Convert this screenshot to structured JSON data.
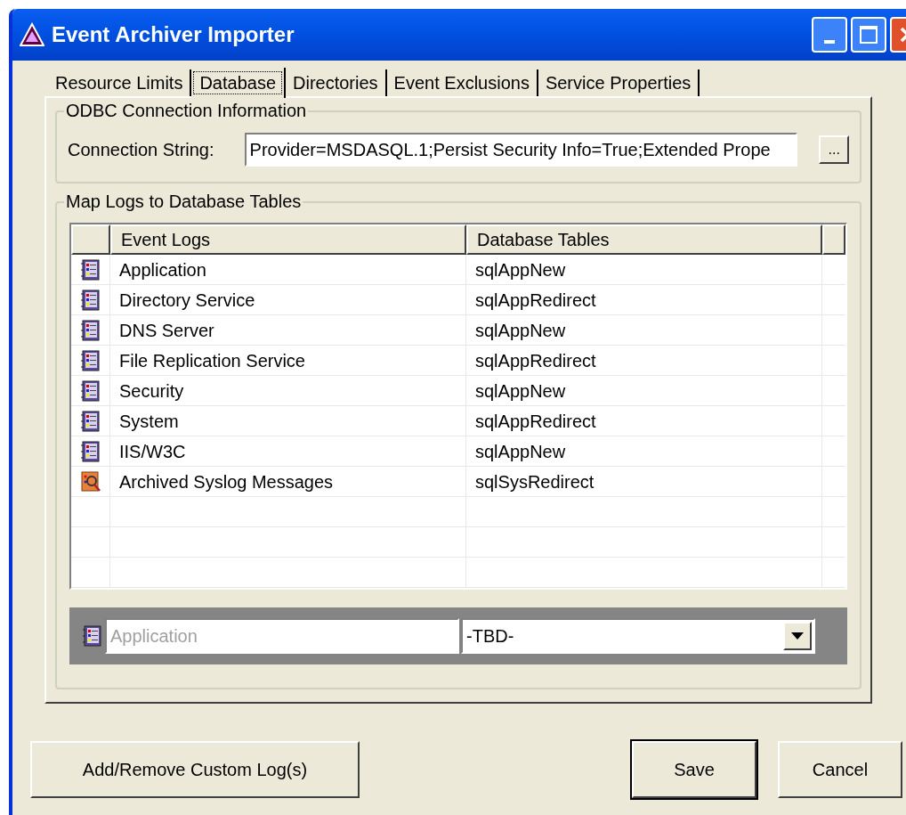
{
  "window": {
    "title": "Event Archiver Importer"
  },
  "tabs": [
    {
      "label": "Resource Limits",
      "selected": false
    },
    {
      "label": "Database",
      "selected": true
    },
    {
      "label": "Directories",
      "selected": false
    },
    {
      "label": "Event Exclusions",
      "selected": false
    },
    {
      "label": "Service Properties",
      "selected": false
    }
  ],
  "odbc": {
    "group_title": "ODBC Connection Information",
    "label": "Connection String:",
    "value": "Provider=MSDASQL.1;Persist Security Info=True;Extended Prope",
    "browse_button": "..."
  },
  "map": {
    "group_title": "Map Logs to Database Tables",
    "columns": [
      "Event Logs",
      "Database Tables"
    ],
    "rows": [
      {
        "kind": "eventlog",
        "log": "Application",
        "table": "sqlAppNew"
      },
      {
        "kind": "eventlog",
        "log": "Directory Service",
        "table": "sqlAppRedirect"
      },
      {
        "kind": "eventlog",
        "log": "DNS Server",
        "table": "sqlAppNew"
      },
      {
        "kind": "eventlog",
        "log": "File Replication Service",
        "table": "sqlAppRedirect"
      },
      {
        "kind": "eventlog",
        "log": "Security",
        "table": "sqlAppNew"
      },
      {
        "kind": "eventlog",
        "log": "System",
        "table": "sqlAppRedirect"
      },
      {
        "kind": "eventlog",
        "log": "IIS/W3C",
        "table": "sqlAppNew"
      },
      {
        "kind": "syslog",
        "log": "Archived Syslog Messages",
        "table": "sqlSysRedirect"
      }
    ],
    "editor": {
      "log_value": "Application",
      "log_disabled": true,
      "table_value": "-TBD-"
    }
  },
  "buttons": [
    {
      "label": "Add/Remove Custom Log(s)"
    },
    {
      "label": "Save",
      "default": true
    },
    {
      "label": "Cancel",
      "default": false
    }
  ]
}
